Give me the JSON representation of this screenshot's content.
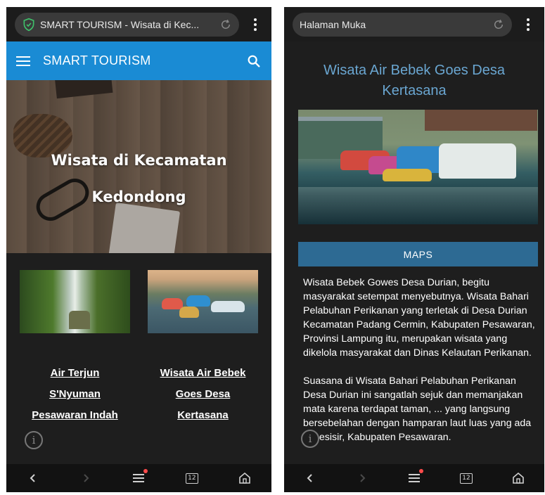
{
  "left": {
    "browser": {
      "url_text": "SMART TOURISM - Wisata di Kec..."
    },
    "app_bar": {
      "title": "SMART TOURISM"
    },
    "hero": {
      "title_line1": "Wisata di Kecamatan",
      "title_line2": "Kedondong"
    },
    "cards": [
      {
        "lines": [
          "Air Terjun",
          "S'Nyuman",
          "Pesawaran Indah"
        ]
      },
      {
        "lines": [
          "Wisata Air Bebek",
          "Goes Desa",
          "Kertasana"
        ]
      }
    ],
    "info_glyph": "i",
    "nav": {
      "tab_count": "12"
    }
  },
  "right": {
    "browser": {
      "url_text": "Halaman Muka"
    },
    "article": {
      "title": "Wisata Air Bebek Goes Desa Kertasana",
      "maps_label": "MAPS",
      "paragraphs": [
        "Wisata Bebek Gowes Desa Durian, begitu masyarakat setempat menyebutnya. Wisata Bahari Pelabuhan Perikanan yang terletak di Desa Durian Kecamatan Padang Cermin, Kabupaten Pesawaran, Provinsi Lampung itu, merupakan wisata yang dikelola masyarakat dan Dinas Kelautan Perikanan.",
        "Suasana di Wisata Bahari Pelabuhan Perikanan Desa Durian ini sangatlah sejuk dan memanjakan mata karena terdapat taman, ... yang langsung bersebelahan dengan hamparan laut luas yang ada di pesisir, Kabupaten Pesawaran."
      ]
    },
    "info_glyph": "i",
    "nav": {
      "tab_count": "12"
    }
  },
  "colors": {
    "app_bar": "#1a8bd4",
    "maps_button": "#2d6a93",
    "article_title": "#6aa6d1",
    "background": "#1e1e1e"
  },
  "icons": [
    "shield-check-icon",
    "reload-icon",
    "kebab-menu-icon",
    "hamburger-icon",
    "search-icon",
    "info-icon",
    "back-icon",
    "forward-icon",
    "menu-icon",
    "tabs-icon",
    "home-icon"
  ]
}
